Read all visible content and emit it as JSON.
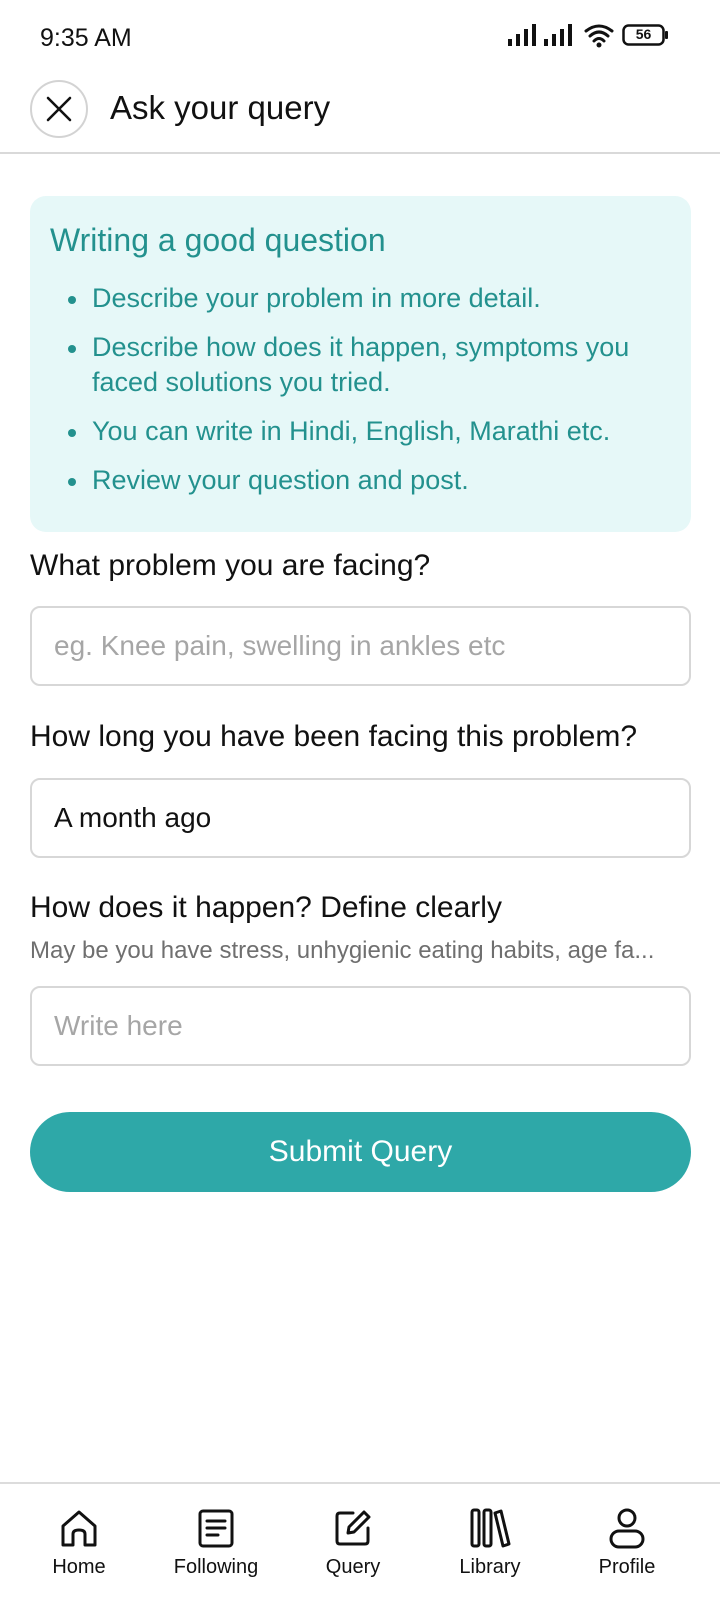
{
  "status_bar": {
    "time": "9:35 AM",
    "battery": "56",
    "icons": [
      "signal-icon",
      "signal-icon",
      "wifi-icon",
      "battery-icon"
    ]
  },
  "header": {
    "title": "Ask your query",
    "close_icon": "close-icon"
  },
  "tips": {
    "title": "Writing a good question",
    "items": [
      "Describe your problem in more detail.",
      "Describe how does it happen, symptoms you faced solutions you tried.",
      "You can write in Hindi, English, Marathi etc.",
      "Review your question and post."
    ]
  },
  "form": {
    "problem_label": "What problem you are facing?",
    "problem_placeholder": "eg. Knee pain, swelling in ankles etc",
    "problem_value": "",
    "duration_label": "How long you have been facing this problem?",
    "duration_value": "A month ago",
    "how_label": "How does it happen? Define clearly",
    "how_hint": "May be you have stress, unhygienic eating habits, age fa...",
    "how_placeholder": "Write here",
    "how_value": "",
    "submit_label": "Submit Query"
  },
  "colors": {
    "accent": "#2ea8a8",
    "tips_text": "#23918e",
    "tips_bg": "#e6f8f8"
  },
  "bottom_nav": [
    {
      "label": "Home",
      "icon": "home-icon"
    },
    {
      "label": "Following",
      "icon": "document-icon"
    },
    {
      "label": "Query",
      "icon": "edit-icon"
    },
    {
      "label": "Library",
      "icon": "library-icon"
    },
    {
      "label": "Profile",
      "icon": "person-icon"
    }
  ]
}
